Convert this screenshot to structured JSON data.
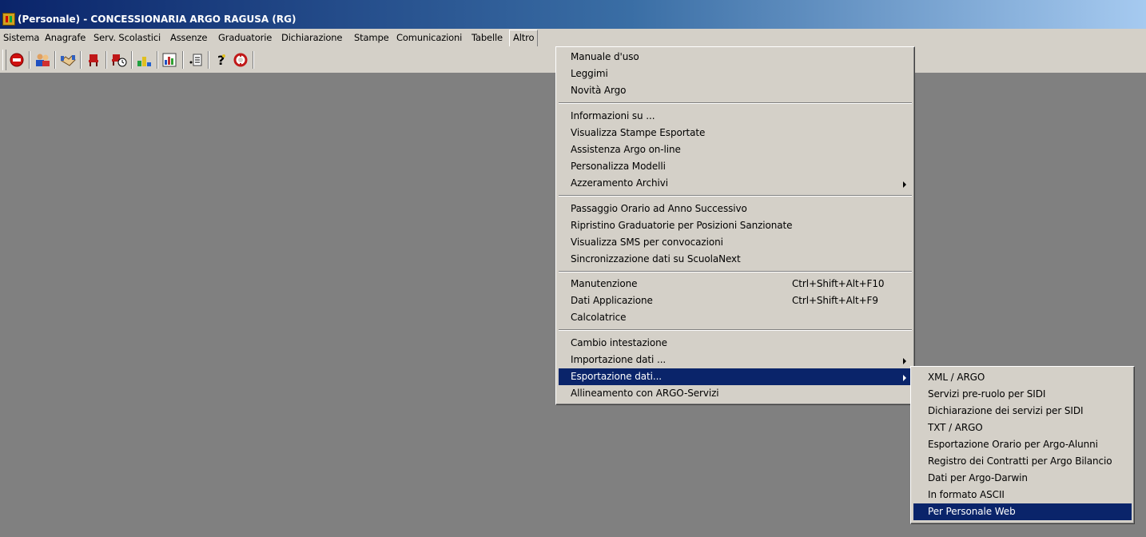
{
  "window": {
    "title": "(Personale) - CONCESSIONARIA ARGO RAGUSA (RG)"
  },
  "menubar": {
    "items": [
      "Sistema",
      "Anagrafe",
      "Serv. Scolastici",
      "Assenze",
      "Graduatorie",
      "Dichiarazione",
      "Stampe",
      "Comunicazioni",
      "Tabelle",
      "Altro"
    ]
  },
  "toolbar": {
    "icons": [
      "stop-icon",
      "people-icon",
      "handshake-icon",
      "chair-icon",
      "chair-clock-icon",
      "ranking-icon",
      "calendar-chart-icon",
      "list-icon",
      "help-icon",
      "lifebuoy-icon"
    ]
  },
  "altro_menu": {
    "items": [
      {
        "label": "Manuale d'uso"
      },
      {
        "label": "Leggimi"
      },
      {
        "label": "Novità Argo"
      },
      {
        "label": "Informazioni su ..."
      },
      {
        "label": "Visualizza Stampe Esportate"
      },
      {
        "label": "Assistenza Argo on-line"
      },
      {
        "label": "Personalizza Modelli"
      },
      {
        "label": "Azzeramento Archivi"
      },
      {
        "label": "Passaggio Orario ad Anno Successivo"
      },
      {
        "label": "Ripristino Graduatorie per Posizioni Sanzionate"
      },
      {
        "label": "Visualizza SMS per convocazioni"
      },
      {
        "label": "Sincronizzazione dati su ScuolaNext"
      },
      {
        "label": "Manutenzione",
        "shortcut": "Ctrl+Shift+Alt+F10"
      },
      {
        "label": "Dati Applicazione",
        "shortcut": "Ctrl+Shift+Alt+F9"
      },
      {
        "label": "Calcolatrice"
      },
      {
        "label": "Cambio intestazione"
      },
      {
        "label": "Importazione dati ..."
      },
      {
        "label": "Esportazione dati..."
      },
      {
        "label": "Allineamento con ARGO-Servizi"
      }
    ]
  },
  "export_submenu": {
    "items": [
      {
        "label": "XML / ARGO"
      },
      {
        "label": "Servizi pre-ruolo per SIDI"
      },
      {
        "label": "Dichiarazione dei servizi per SIDI"
      },
      {
        "label": "TXT / ARGO"
      },
      {
        "label": "Esportazione Orario per Argo-Alunni"
      },
      {
        "label": "Registro dei Contratti per Argo Bilancio"
      },
      {
        "label": "Dati per Argo-Darwin"
      },
      {
        "label": "In formato ASCII"
      },
      {
        "label": "Per Personale Web"
      }
    ]
  },
  "colors": {
    "highlight": "#0a246a",
    "face": "#d4d0c8",
    "desktop": "#808080"
  }
}
